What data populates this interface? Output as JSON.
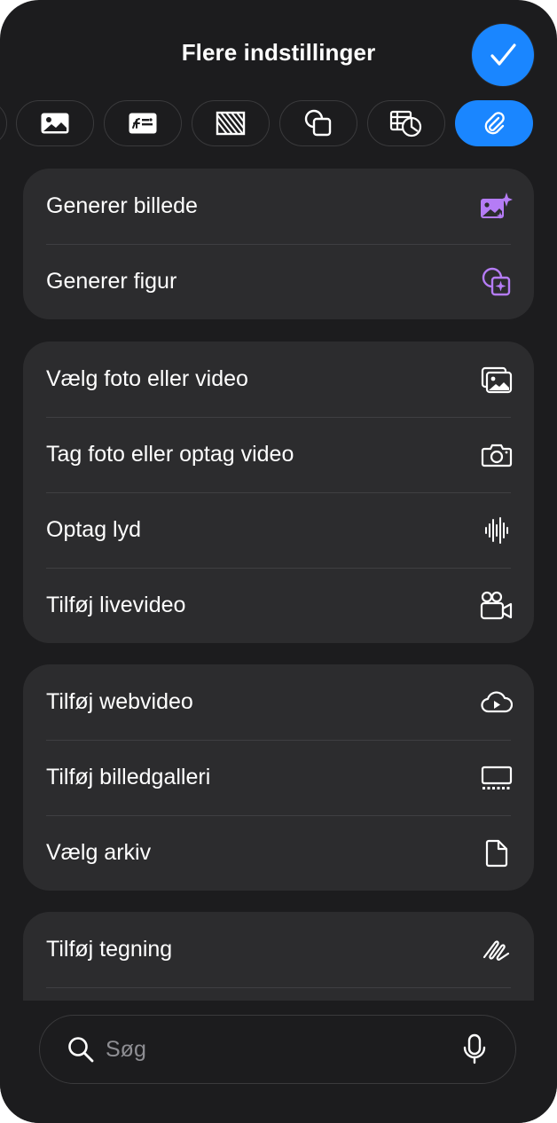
{
  "header": {
    "title": "Flere indstillinger",
    "done_icon": "checkmark-icon"
  },
  "tabs": [
    {
      "icon": "partial-tab-icon",
      "active": false
    },
    {
      "icon": "image-icon",
      "active": false
    },
    {
      "icon": "gallery-icon",
      "active": false
    },
    {
      "icon": "hatched-fill-icon",
      "active": false
    },
    {
      "icon": "shapes-icon",
      "active": false
    },
    {
      "icon": "table-chart-icon",
      "active": false
    },
    {
      "icon": "paperclip-icon",
      "active": true
    }
  ],
  "groups": [
    {
      "items": [
        {
          "label": "Generer billede",
          "icon": "generate-image-icon"
        },
        {
          "label": "Generer figur",
          "icon": "generate-shape-icon"
        }
      ]
    },
    {
      "items": [
        {
          "label": "Vælg foto eller video",
          "icon": "photos-icon"
        },
        {
          "label": "Tag foto eller optag video",
          "icon": "camera-icon"
        },
        {
          "label": "Optag lyd",
          "icon": "waveform-icon"
        },
        {
          "label": "Tilføj livevideo",
          "icon": "live-video-icon"
        }
      ]
    },
    {
      "items": [
        {
          "label": "Tilføj webvideo",
          "icon": "cloud-play-icon"
        },
        {
          "label": "Tilføj billedgalleri",
          "icon": "gallery-icon"
        },
        {
          "label": "Vælg arkiv",
          "icon": "document-icon"
        }
      ]
    },
    {
      "items": [
        {
          "label": "Tilføj tegning",
          "icon": "drawing-icon"
        }
      ]
    }
  ],
  "search": {
    "placeholder": "Søg",
    "search_icon": "magnifying-glass-icon",
    "mic_icon": "microphone-icon"
  },
  "colors": {
    "accent": "#1a86ff",
    "ai_purple": "#b57cf6",
    "sheet_bg": "#1c1c1e",
    "group_bg": "#2c2c2e"
  }
}
